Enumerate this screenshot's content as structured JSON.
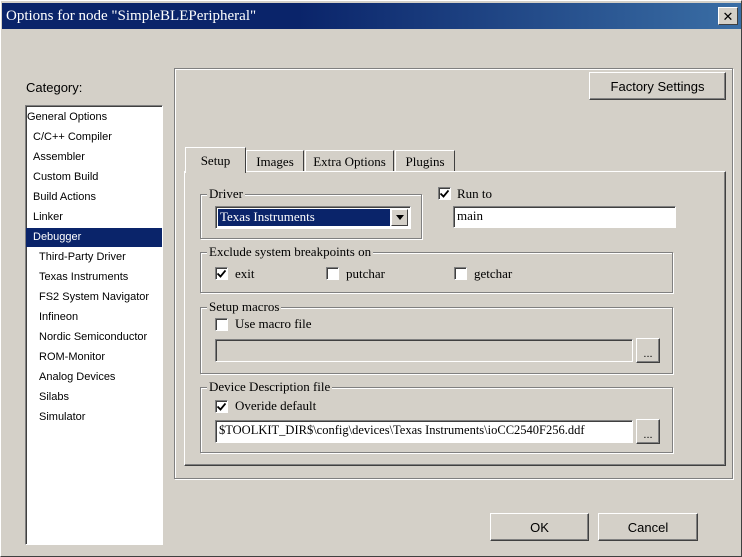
{
  "window": {
    "title": "Options for node \"SimpleBLEPeripheral\"",
    "close_glyph": "✕"
  },
  "category": {
    "label": "Category:",
    "items": [
      {
        "label": "General Options",
        "indent": 0
      },
      {
        "label": "C/C++ Compiler",
        "indent": 1
      },
      {
        "label": "Assembler",
        "indent": 1
      },
      {
        "label": "Custom Build",
        "indent": 1
      },
      {
        "label": "Build Actions",
        "indent": 1
      },
      {
        "label": "Linker",
        "indent": 1
      },
      {
        "label": "Debugger",
        "indent": 1,
        "selected": true
      },
      {
        "label": "Third-Party Driver",
        "indent": 2
      },
      {
        "label": "Texas Instruments",
        "indent": 2
      },
      {
        "label": "FS2 System Navigator",
        "indent": 2
      },
      {
        "label": "Infineon",
        "indent": 2
      },
      {
        "label": "Nordic Semiconductor",
        "indent": 2
      },
      {
        "label": "ROM-Monitor",
        "indent": 2
      },
      {
        "label": "Analog Devices",
        "indent": 2
      },
      {
        "label": "Silabs",
        "indent": 2
      },
      {
        "label": "Simulator",
        "indent": 2
      }
    ]
  },
  "factory_settings_label": "Factory Settings",
  "tabs": [
    {
      "label": "Setup",
      "active": true
    },
    {
      "label": "Images"
    },
    {
      "label": "Extra Options"
    },
    {
      "label": "Plugins"
    }
  ],
  "setup": {
    "driver": {
      "group_label": "Driver",
      "selected": "Texas Instruments"
    },
    "run_to": {
      "label": "Run to",
      "checked": true,
      "value": "main"
    },
    "exclude_breakpoints": {
      "group_label": "Exclude system breakpoints on",
      "options": [
        {
          "label": "exit",
          "checked": true
        },
        {
          "label": "putchar",
          "checked": false
        },
        {
          "label": "getchar",
          "checked": false
        }
      ]
    },
    "setup_macros": {
      "group_label": "Setup macros",
      "use_macro_label": "Use macro file",
      "checked": false,
      "path": "",
      "browse_label": "..."
    },
    "device_description": {
      "group_label": "Device Description file",
      "override_label": "Overide default",
      "checked": true,
      "path": "$TOOLKIT_DIR$\\config\\devices\\Texas Instruments\\ioCC2540F256.ddf",
      "browse_label": "..."
    }
  },
  "buttons": {
    "ok": "OK",
    "cancel": "Cancel"
  },
  "colors": {
    "titlebar": "#0a246a",
    "face": "#d4d0c8",
    "selection": "#0a246a"
  }
}
